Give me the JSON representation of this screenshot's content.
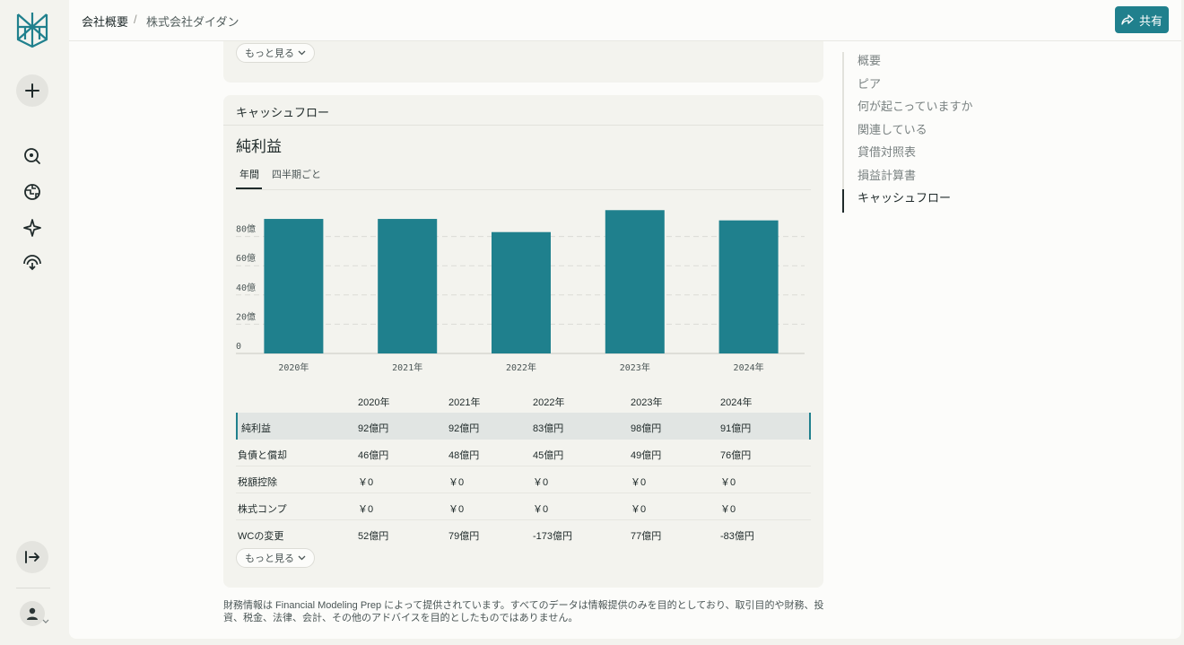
{
  "breadcrumb": {
    "parent": "会社概要",
    "separator": "/",
    "current": "株式会社ダイダン"
  },
  "share_label": "共有",
  "top_card": {
    "more_label": "もっと見る"
  },
  "cashflow": {
    "section_title": "キャッシュフロー",
    "metric_title": "純利益",
    "tabs": [
      "年間",
      "四半期ごと"
    ],
    "active_tab": "年間",
    "more_label": "もっと見る"
  },
  "chart_data": {
    "type": "bar",
    "categories": [
      "2020年",
      "2021年",
      "2022年",
      "2023年",
      "2024年"
    ],
    "values": [
      92,
      92,
      83,
      98,
      91
    ],
    "yticks": [
      "0",
      "20億",
      "40億",
      "60億",
      "80億"
    ],
    "ylim": [
      0,
      100
    ],
    "grid": true,
    "color": "#1f808d"
  },
  "table": {
    "columns": [
      "",
      "2020年",
      "2021年",
      "2022年",
      "2023年",
      "2024年"
    ],
    "rows": [
      {
        "label": "純利益",
        "values": [
          "92億円",
          "92億円",
          "83億円",
          "98億円",
          "91億円"
        ],
        "highlighted": true
      },
      {
        "label": "負債と償却",
        "values": [
          "46億円",
          "48億円",
          "45億円",
          "49億円",
          "76億円"
        ]
      },
      {
        "label": "税額控除",
        "values": [
          "￥0",
          "￥0",
          "￥0",
          "￥0",
          "￥0"
        ]
      },
      {
        "label": "株式コンプ",
        "values": [
          "￥0",
          "￥0",
          "￥0",
          "￥0",
          "￥0"
        ]
      },
      {
        "label": "WCの変更",
        "values": [
          "52億円",
          "79億円",
          "-173億円",
          "77億円",
          "-83億円"
        ]
      }
    ]
  },
  "disclaimer_line1": "財務情報は Financial Modeling Prep によって提供されています。すべてのデータは情報提供のみを目的としており、取引目的や財務、投",
  "disclaimer_line2": "資、税金、法律、会計、その他のアドバイスを目的としたものではありません。",
  "toc": {
    "items": [
      "概要",
      "ピア",
      "何が起こっていますか",
      "関連している",
      "貸借対照表",
      "損益計算書",
      "キャッシュフロー"
    ],
    "active": "キャッシュフロー"
  },
  "colors": {
    "accent": "#20808d",
    "bar": "#1f808d"
  },
  "rail_icons": [
    "logo-icon",
    "new-thread-icon",
    "search-icon",
    "discover-icon",
    "spaces-icon",
    "library-icon",
    "expand-sidebar-icon",
    "user-icon"
  ]
}
